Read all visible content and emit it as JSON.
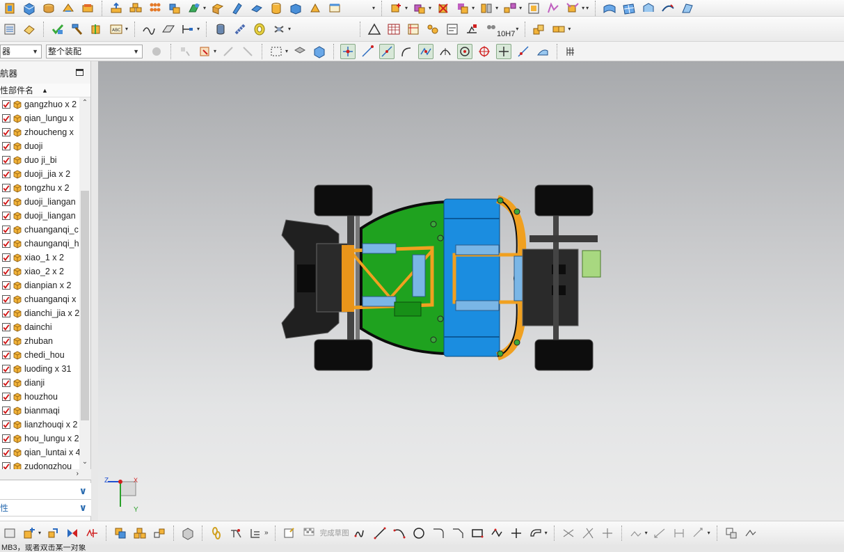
{
  "toolbar": {
    "selection_filter_value": "器",
    "assembly_scope_value": "整个装配",
    "tolerance_label": "10H7",
    "sketch_finish_label": "完成草图"
  },
  "navigator": {
    "title": "航器",
    "column_header": "性部件名",
    "items": [
      {
        "label": "gangzhuo x 2",
        "checked": true
      },
      {
        "label": "qian_lungu x",
        "checked": true
      },
      {
        "label": "zhoucheng x",
        "checked": true
      },
      {
        "label": "duoji",
        "checked": true
      },
      {
        "label": "duo ji_bi",
        "checked": true
      },
      {
        "label": "duoji_jia x 2",
        "checked": true
      },
      {
        "label": "tongzhu x 2",
        "checked": true
      },
      {
        "label": "duoji_liangan",
        "checked": true
      },
      {
        "label": "duoji_liangan",
        "checked": true
      },
      {
        "label": "chuanganqi_c",
        "checked": true
      },
      {
        "label": "chaunganqi_h",
        "checked": true
      },
      {
        "label": "xiao_1 x 2",
        "checked": true
      },
      {
        "label": "xiao_2 x 2",
        "checked": true
      },
      {
        "label": "dianpian x 2",
        "checked": true
      },
      {
        "label": "chuanganqi x",
        "checked": true
      },
      {
        "label": "dianchi_jia x 2",
        "checked": true
      },
      {
        "label": "dainchi",
        "checked": true
      },
      {
        "label": "zhuban",
        "checked": true
      },
      {
        "label": "chedi_hou",
        "checked": true
      },
      {
        "label": "luoding x 31",
        "checked": true
      },
      {
        "label": "dianji",
        "checked": true
      },
      {
        "label": "houzhou",
        "checked": true
      },
      {
        "label": "bianmaqi",
        "checked": true
      },
      {
        "label": "lianzhouqi x 2",
        "checked": true
      },
      {
        "label": "hou_lungu x 2",
        "checked": true
      },
      {
        "label": "qian_luntai x 4",
        "checked": true
      },
      {
        "label": "zudongzhou",
        "checked": true
      }
    ],
    "panel_details": "",
    "panel_properties": "性"
  },
  "triad": {
    "z": "Z",
    "x": "X",
    "y": "Y"
  },
  "status": {
    "text": "MB3，或者双击某一对象"
  },
  "colors": {
    "accent_blue": "#1b8de0",
    "chassis_green": "#1fa21f",
    "frame_orange": "#f0a020",
    "check_red": "#d01010"
  }
}
